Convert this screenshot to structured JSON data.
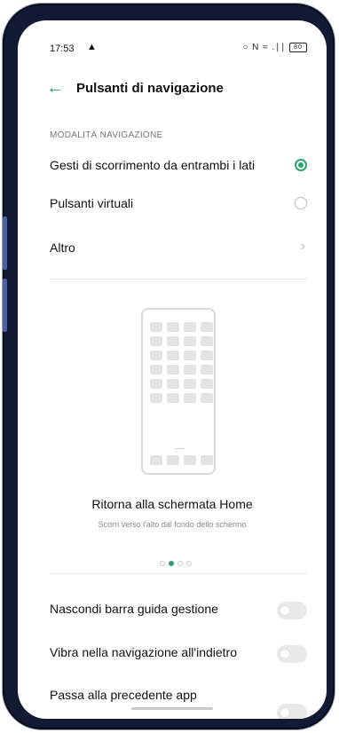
{
  "status_bar": {
    "time": "17:53",
    "cloud_icon": "cloud-icon",
    "indicators": "○ N ≈ .∣∣",
    "battery": "80"
  },
  "header": {
    "back_icon": "back-arrow-icon",
    "title": "Pulsanti di navigazione"
  },
  "section_label": "MODALITÀ NAVIGAZIONE",
  "nav_options": [
    {
      "label": "Gesti di scorrimento da entrambi i lati",
      "selected": true
    },
    {
      "label": "Pulsanti virtuali",
      "selected": false
    },
    {
      "label": "Altro",
      "type": "link"
    }
  ],
  "illustration": {
    "title": "Ritorna alla schermata Home",
    "subtitle": "Scorri verso l'alto dal fondo dello schermo",
    "page_count": 4,
    "active_page": 2
  },
  "toggles": [
    {
      "label": "Nascondi barra guida gestione",
      "on": false
    },
    {
      "label": "Vibra nella navigazione all'indietro",
      "on": false
    },
    {
      "label": "Passa alla precedente app",
      "on": false
    }
  ],
  "colors": {
    "accent": "#25a56a",
    "frame": "#121b33"
  }
}
